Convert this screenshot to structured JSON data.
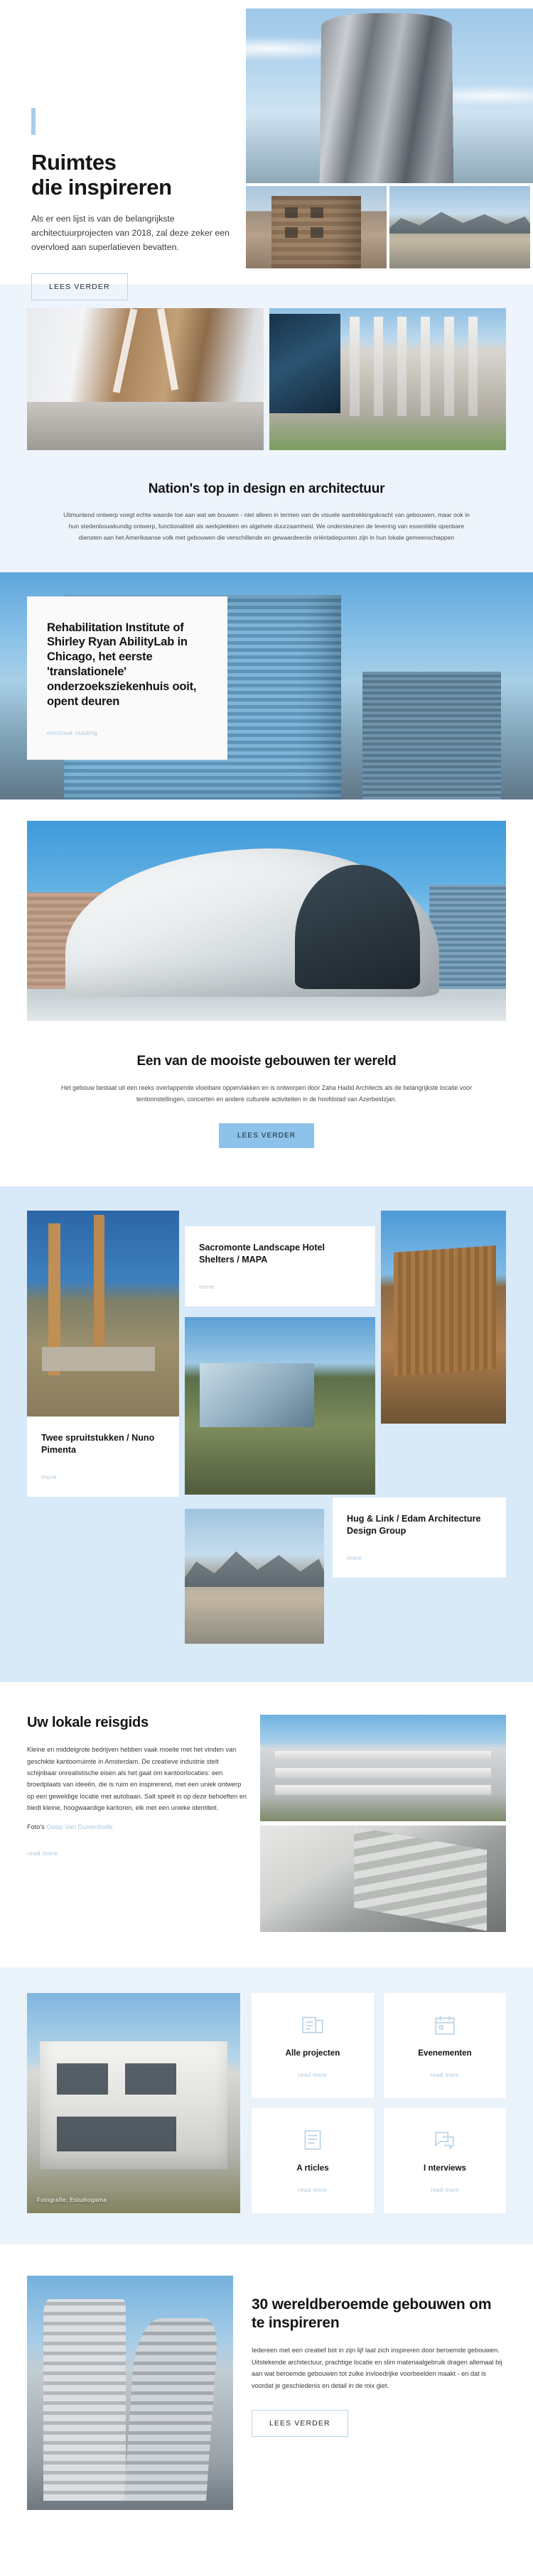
{
  "hero": {
    "title_line1": "Ruimtes",
    "title_line2": "die inspireren",
    "subtitle": "Als er een lijst is van de belangrijkste architectuurprojecten van 2018, zal deze zeker een overvloed aan superlatieven bevatten.",
    "button": "Lees verder",
    "accent_color": "#a8cdec"
  },
  "nation": {
    "title": "Nation's top in design en architectuur",
    "paragraph": "Uitmuntend ontwerp voegt echte waarde toe aan wat we bouwen - niet alleen in termen van de visuele aantrekkingskracht van gebouwen, maar ook in hun stedenbouwkundig ontwerp, functionaliteit als werkplekken en algehele duurzaamheid. We ondersteunen de levering van essentiële openbare diensten aan het Amerikaanse volk met gebouwen die verschillende en gewaardeerde oriëntatiepunten zijn in hun lokale gemeenschappen",
    "background_color": "#eef4fb"
  },
  "rehab": {
    "title": "Rehabilitation Institute of Shirley Ryan AbilityLab in Chicago, het eerste 'translationele' onderzoeksziekenhuis ooit, opent deuren",
    "link": "continue reading"
  },
  "heydar": {
    "title": "Een van de mooiste gebouwen ter wereld",
    "paragraph": "Het gebouw bestaat uit een reeks overlappende vloeibare oppervlakken en is ontworpen door Zaha Hadid Architects als de belangrijkste locatie voor tentoonstellingen, concerten en andere culturele activiteiten in de hoofdstad van Azerbeidzjan.",
    "button": "Lees verder",
    "button_color": "#8dc3ea"
  },
  "projects": {
    "background_color": "#d8e9f7",
    "cards": [
      {
        "title": "Sacromonte Landscape Hotel Shelters / MAPA",
        "link": "more"
      },
      {
        "title": "Twee spruitstukken / Nuno Pimenta",
        "link": "more"
      },
      {
        "title": "Hug & Link / Edam Architecture Design Group",
        "link": "more"
      }
    ]
  },
  "guide": {
    "title": "Uw lokale reisgids",
    "paragraph": "Kleine en middelgrote bedrijven hebben vaak moeite met het vinden van geschikte kantoorruimte in Amsterdam. De creatieve industrie stelt schijnbaar onrealistische eisen als het gaat om kantoorlocaties: een broedplaats van ideeën, die is ruim en inspirerend, met een uniek ontwerp op een geweldige locatie met autobaan. Salt speelt in op deze behoeften en biedt kleine, hoogwaardige kantoren, elk met een unieke identiteit.",
    "credit_label": "Foto's",
    "credit_name": "Ossip Van Duivenbode",
    "link": "read more"
  },
  "icons": {
    "background_color": "#eaf2fa",
    "photo_caption": "Fotografie: Estudiogama",
    "cards": [
      {
        "icon": "projects-icon",
        "title": "Alle projecten",
        "link": "read more"
      },
      {
        "icon": "calendar-icon",
        "title": "Evenementen",
        "link": "read more"
      },
      {
        "icon": "article-icon",
        "title": "A rticles",
        "link": "read more"
      },
      {
        "icon": "interview-icon",
        "title": "I nterviews",
        "link": "read more"
      }
    ]
  },
  "final": {
    "title": "30 wereldberoemde gebouwen om te inspireren",
    "paragraph": "Iedereen met een creatief bot in zijn lijf laat zich inspireren door beroemde gebouwen. Uitstekende architectuur, prachtige locatie en slim materiaalgebruik dragen allemaal bij aan wat beroemde gebouwen tot zulke invloedrijke voorbeelden maakt - en dat is voordat je geschiedenis en detail in de mix giet.",
    "button": "Lees verder"
  }
}
